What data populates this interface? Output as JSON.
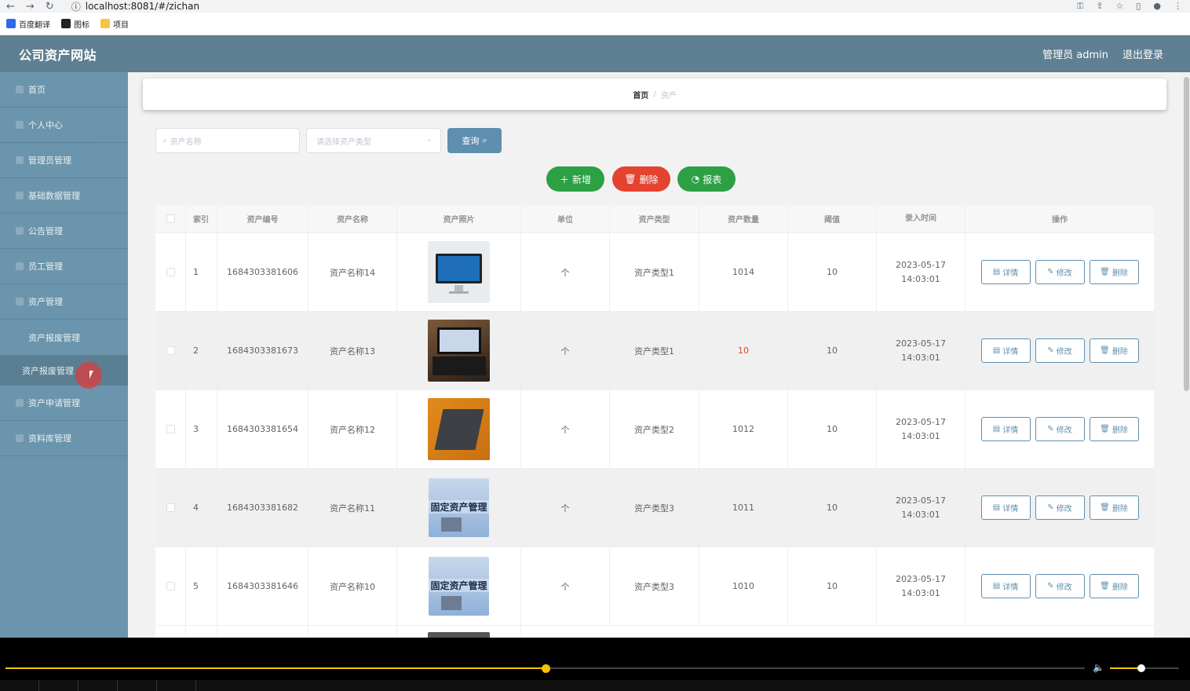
{
  "browser": {
    "url": "localhost:8081/#/zichan",
    "bookmarks": [
      "百度翻译",
      "图标",
      "项目"
    ]
  },
  "header": {
    "title": "公司资产网站",
    "user_label": "管理员 admin",
    "logout_label": "退出登录"
  },
  "sidebar": {
    "items": [
      {
        "label": "首页"
      },
      {
        "label": "个人中心"
      },
      {
        "label": "管理员管理"
      },
      {
        "label": "基础数据管理"
      },
      {
        "label": "公告管理"
      },
      {
        "label": "员工管理"
      },
      {
        "label": "资产管理"
      },
      {
        "label": "资产报废管理"
      },
      {
        "label": "资产申请管理"
      },
      {
        "label": "资料库管理"
      }
    ],
    "sub_item_label": "资产报废管理"
  },
  "breadcrumb": {
    "home": "首页",
    "separator": "/",
    "current": "资产"
  },
  "search": {
    "name_placeholder": "资产名称",
    "type_placeholder": "请选择资产类型",
    "query_label": "查询"
  },
  "actions": {
    "add": "新增",
    "delete": "删除",
    "report": "报表"
  },
  "table": {
    "headers": [
      "索引",
      "资产编号",
      "资产名称",
      "资产照片",
      "单位",
      "资产类型",
      "资产数量",
      "阈值",
      "录入时间",
      "操作"
    ],
    "op_labels": {
      "detail": "详情",
      "edit": "修改",
      "delete": "删除"
    },
    "rows": [
      {
        "index": "1",
        "code": "1684303381606",
        "name": "资产名称14",
        "photo": "imac",
        "unit": "个",
        "type": "资产类型1",
        "qty": "1014",
        "qty_warn": false,
        "threshold": "10",
        "time": "2023-05-17 14:03:01"
      },
      {
        "index": "2",
        "code": "1684303381673",
        "name": "资产名称13",
        "photo": "laptop1",
        "unit": "个",
        "type": "资产类型1",
        "qty": "10",
        "qty_warn": true,
        "threshold": "10",
        "time": "2023-05-17 14:03:01"
      },
      {
        "index": "3",
        "code": "1684303381654",
        "name": "资产名称12",
        "photo": "laptop2",
        "unit": "个",
        "type": "资产类型2",
        "qty": "1012",
        "qty_warn": false,
        "threshold": "10",
        "time": "2023-05-17 14:03:01"
      },
      {
        "index": "4",
        "code": "1684303381682",
        "name": "资产名称11",
        "photo": "asset",
        "unit": "个",
        "type": "资产类型3",
        "qty": "1011",
        "qty_warn": false,
        "threshold": "10",
        "time": "2023-05-17 14:03:01"
      },
      {
        "index": "5",
        "code": "1684303381646",
        "name": "资产名称10",
        "photo": "asset",
        "unit": "个",
        "type": "资产类型3",
        "qty": "1010",
        "qty_warn": false,
        "threshold": "10",
        "time": "2023-05-17 14:03:01"
      }
    ],
    "photo_caption": "固定资产管理"
  },
  "player": {
    "progress": 0.5,
    "volume": 0.45
  },
  "colors": {
    "header": "#5f7f92",
    "sidebar": "#6b95ac",
    "primary": "#5f8fae",
    "success": "#2ea044",
    "danger": "#e3432f"
  }
}
